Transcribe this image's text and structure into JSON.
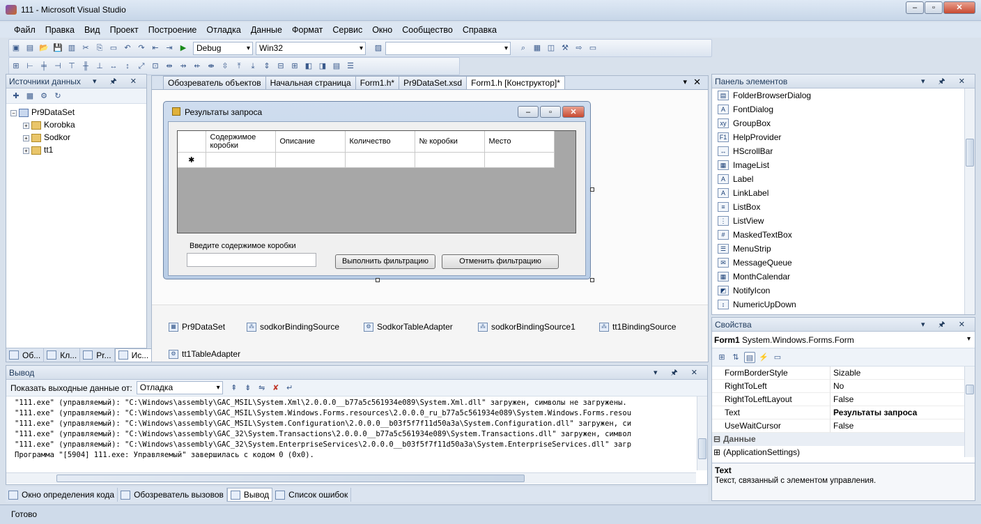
{
  "window": {
    "title": "111 - Microsoft Visual Studio"
  },
  "menu": [
    "Файл",
    "Правка",
    "Вид",
    "Проект",
    "Построение",
    "Отладка",
    "Данные",
    "Формат",
    "Сервис",
    "Окно",
    "Сообщество",
    "Справка"
  ],
  "toolbar": {
    "config": "Debug",
    "platform": "Win32",
    "find": ""
  },
  "datasources": {
    "title": "Источники данных",
    "root": "Pr9DataSet",
    "children": [
      "Korobka",
      "Sodkor",
      "tt1"
    ],
    "tabs": [
      "Об...",
      "Кл...",
      "Pr...",
      "Ис..."
    ]
  },
  "doc_tabs": [
    "Обозреватель объектов",
    "Начальная страница",
    "Form1.h*",
    "Pr9DataSet.xsd",
    "Form1.h [Конструктор]*"
  ],
  "form": {
    "title": "Результаты запроса",
    "columns": [
      "Содержимое коробки",
      "Описание",
      "Количество",
      "№ коробки",
      "Место"
    ],
    "newrow_marker": "✱",
    "filter_label": "Введите содержимое коробки",
    "filter_value": "",
    "apply_button": "Выполнить фильтрацию",
    "cancel_button": "Отменить фильтрацию"
  },
  "tray": [
    "Pr9DataSet",
    "sodkorBindingSource",
    "SodkorTableAdapter",
    "sodkorBindingSource1",
    "tt1BindingSource",
    "tt1TableAdapter"
  ],
  "toolbox": {
    "title": "Панель элементов",
    "items": [
      {
        "label": "FolderBrowserDialog",
        "icon": "folder-dialog-icon",
        "glyph": "▤"
      },
      {
        "label": "FontDialog",
        "icon": "font-dialog-icon",
        "glyph": "A"
      },
      {
        "label": "GroupBox",
        "icon": "groupbox-icon",
        "glyph": "xy"
      },
      {
        "label": "HelpProvider",
        "icon": "help-provider-icon",
        "glyph": "F1"
      },
      {
        "label": "HScrollBar",
        "icon": "hscrollbar-icon",
        "glyph": "↔"
      },
      {
        "label": "ImageList",
        "icon": "imagelist-icon",
        "glyph": "▦"
      },
      {
        "label": "Label",
        "icon": "label-icon",
        "glyph": "A"
      },
      {
        "label": "LinkLabel",
        "icon": "linklabel-icon",
        "glyph": "A"
      },
      {
        "label": "ListBox",
        "icon": "listbox-icon",
        "glyph": "≡"
      },
      {
        "label": "ListView",
        "icon": "listview-icon",
        "glyph": "⋮"
      },
      {
        "label": "MaskedTextBox",
        "icon": "maskedtextbox-icon",
        "glyph": "#"
      },
      {
        "label": "MenuStrip",
        "icon": "menustrip-icon",
        "glyph": "☰"
      },
      {
        "label": "MessageQueue",
        "icon": "messagequeue-icon",
        "glyph": "✉"
      },
      {
        "label": "MonthCalendar",
        "icon": "monthcalendar-icon",
        "glyph": "▦"
      },
      {
        "label": "NotifyIcon",
        "icon": "notifyicon-icon",
        "glyph": "◩"
      },
      {
        "label": "NumericUpDown",
        "icon": "numericupdown-icon",
        "glyph": "↕"
      }
    ]
  },
  "properties": {
    "title": "Свойства",
    "object_name": "Form1",
    "object_type": "System.Windows.Forms.Form",
    "rows": [
      {
        "name": "FormBorderStyle",
        "value": "Sizable",
        "bold": false
      },
      {
        "name": "RightToLeft",
        "value": "No",
        "bold": false
      },
      {
        "name": "RightToLeftLayout",
        "value": "False",
        "bold": false
      },
      {
        "name": "Text",
        "value": "Результаты запроса",
        "bold": true
      },
      {
        "name": "UseWaitCursor",
        "value": "False",
        "bold": false
      }
    ],
    "category": "Данные",
    "category_item": "(ApplicationSettings)",
    "desc_title": "Text",
    "desc_text": "Текст, связанный с элементом управления."
  },
  "output": {
    "title": "Вывод",
    "show_label": "Показать выходные данные от:",
    "source": "Отладка",
    "lines": [
      "\"111.exe\" (управляемый): \"C:\\Windows\\assembly\\GAC_MSIL\\System.Xml\\2.0.0.0__b77a5c561934e089\\System.Xml.dll\" загружен, символы не загружены.",
      "\"111.exe\" (управляемый): \"C:\\Windows\\assembly\\GAC_MSIL\\System.Windows.Forms.resources\\2.0.0.0_ru_b77a5c561934e089\\System.Windows.Forms.resou",
      "\"111.exe\" (управляемый): \"C:\\Windows\\assembly\\GAC_MSIL\\System.Configuration\\2.0.0.0__b03f5f7f11d50a3a\\System.Configuration.dll\" загружен, си",
      "\"111.exe\" (управляемый): \"C:\\Windows\\assembly\\GAC_32\\System.Transactions\\2.0.0.0__b77a5c561934e089\\System.Transactions.dll\" загружен, символ",
      "\"111.exe\" (управляемый): \"C:\\Windows\\assembly\\GAC_32\\System.EnterpriseServices\\2.0.0.0__b03f5f7f11d50a3a\\System.EnterpriseServices.dll\" загр",
      "Программа \"[5904] 111.exe: Управляемый\" завершилась с кодом 0 (0x0)."
    ]
  },
  "bottom_tabs": [
    "Окно определения кода",
    "Обозреватель вызовов",
    "Вывод",
    "Список ошибок"
  ],
  "status": "Готово"
}
